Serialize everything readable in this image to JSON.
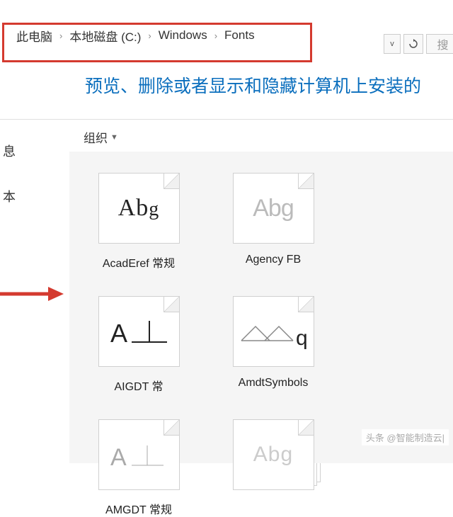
{
  "breadcrumb": {
    "items": [
      "此电脑",
      "本地磁盘 (C:)",
      "Windows",
      "Fonts"
    ]
  },
  "nav": {
    "search_placeholder": "搜"
  },
  "heading": "预览、删除或者显示和隐藏计算机上安装的",
  "left": {
    "item1": "息",
    "item2": "本"
  },
  "toolbar": {
    "organize": "组织"
  },
  "fonts": [
    {
      "sample": "Abg",
      "label": "AcadEref 常规",
      "style": "normal"
    },
    {
      "sample": "Abg",
      "label": "Agency FB",
      "style": "light-abg"
    },
    {
      "sample": "perp",
      "label": "AIGDT 常",
      "style": "perp"
    },
    {
      "sample": "triangles",
      "label": "AmdtSymbols",
      "style": "triangles"
    },
    {
      "sample": "perp",
      "label": "AMGDT 常规",
      "style": "thin-perp"
    },
    {
      "sample": "Abg",
      "label": "",
      "style": "grey-abg"
    }
  ],
  "watermark": "头条 @智能制造云|"
}
